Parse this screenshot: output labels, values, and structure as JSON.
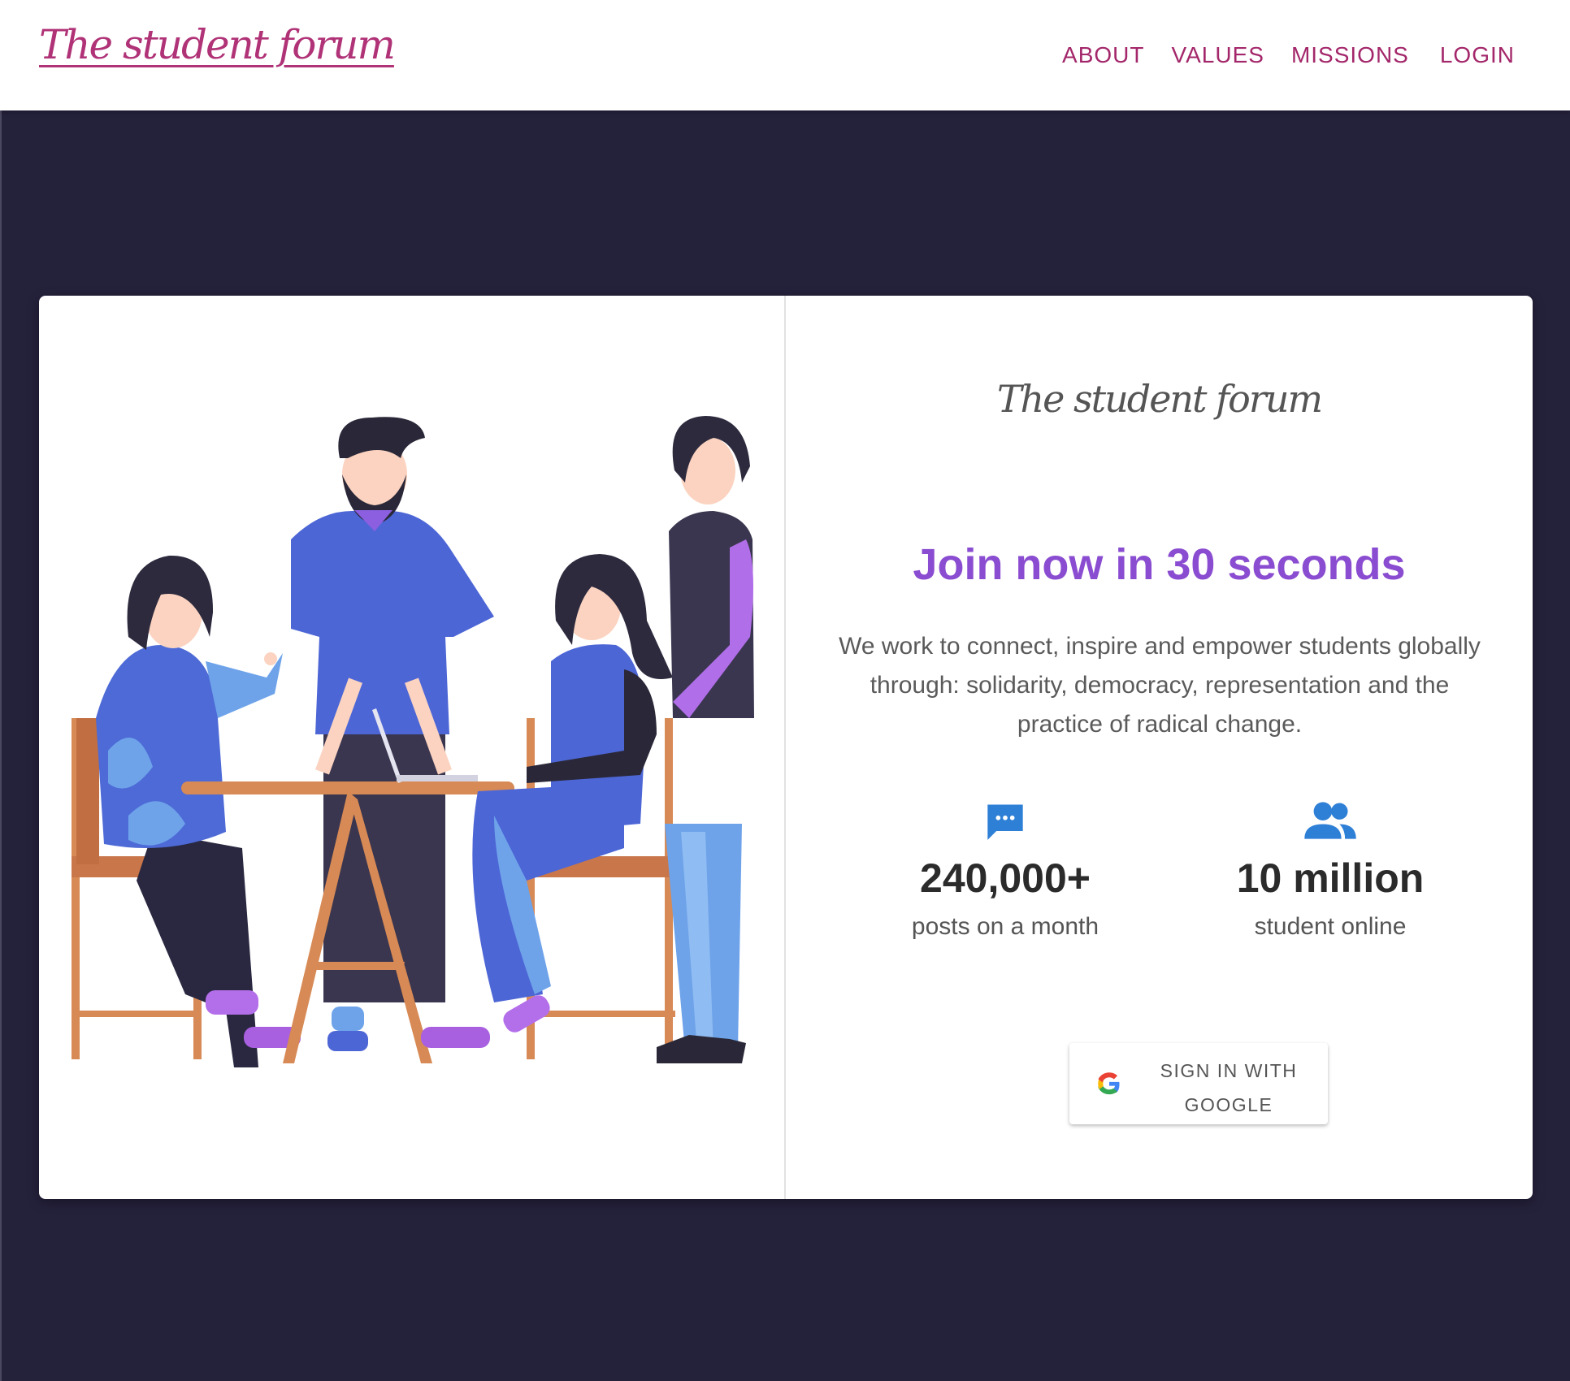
{
  "header": {
    "brand": "The student forum",
    "nav": [
      {
        "label": "ABOUT"
      },
      {
        "label": "VALUES"
      },
      {
        "label": "MISSIONS"
      },
      {
        "label": "LOGIN"
      }
    ]
  },
  "hero": {
    "brand": "The student forum",
    "heading": "Join now in 30 seconds",
    "description": "We work to connect, inspire and empower students globally through: solidarity, democracy, representation and the practice of radical change.",
    "stats": [
      {
        "icon": "chat-bubble-icon",
        "value": "240,000+",
        "label": "posts on a month"
      },
      {
        "icon": "people-group-icon",
        "value": "10 million",
        "label": "student online"
      }
    ],
    "signin": {
      "icon": "google-g-icon",
      "label": "SIGN IN WITH GOOGLE"
    }
  },
  "colors": {
    "page_background": "#24213b",
    "brand": "#b03277",
    "nav": "#a3276a",
    "heading": "#8a4cd0",
    "stat_icon": "#2e7fd6"
  }
}
